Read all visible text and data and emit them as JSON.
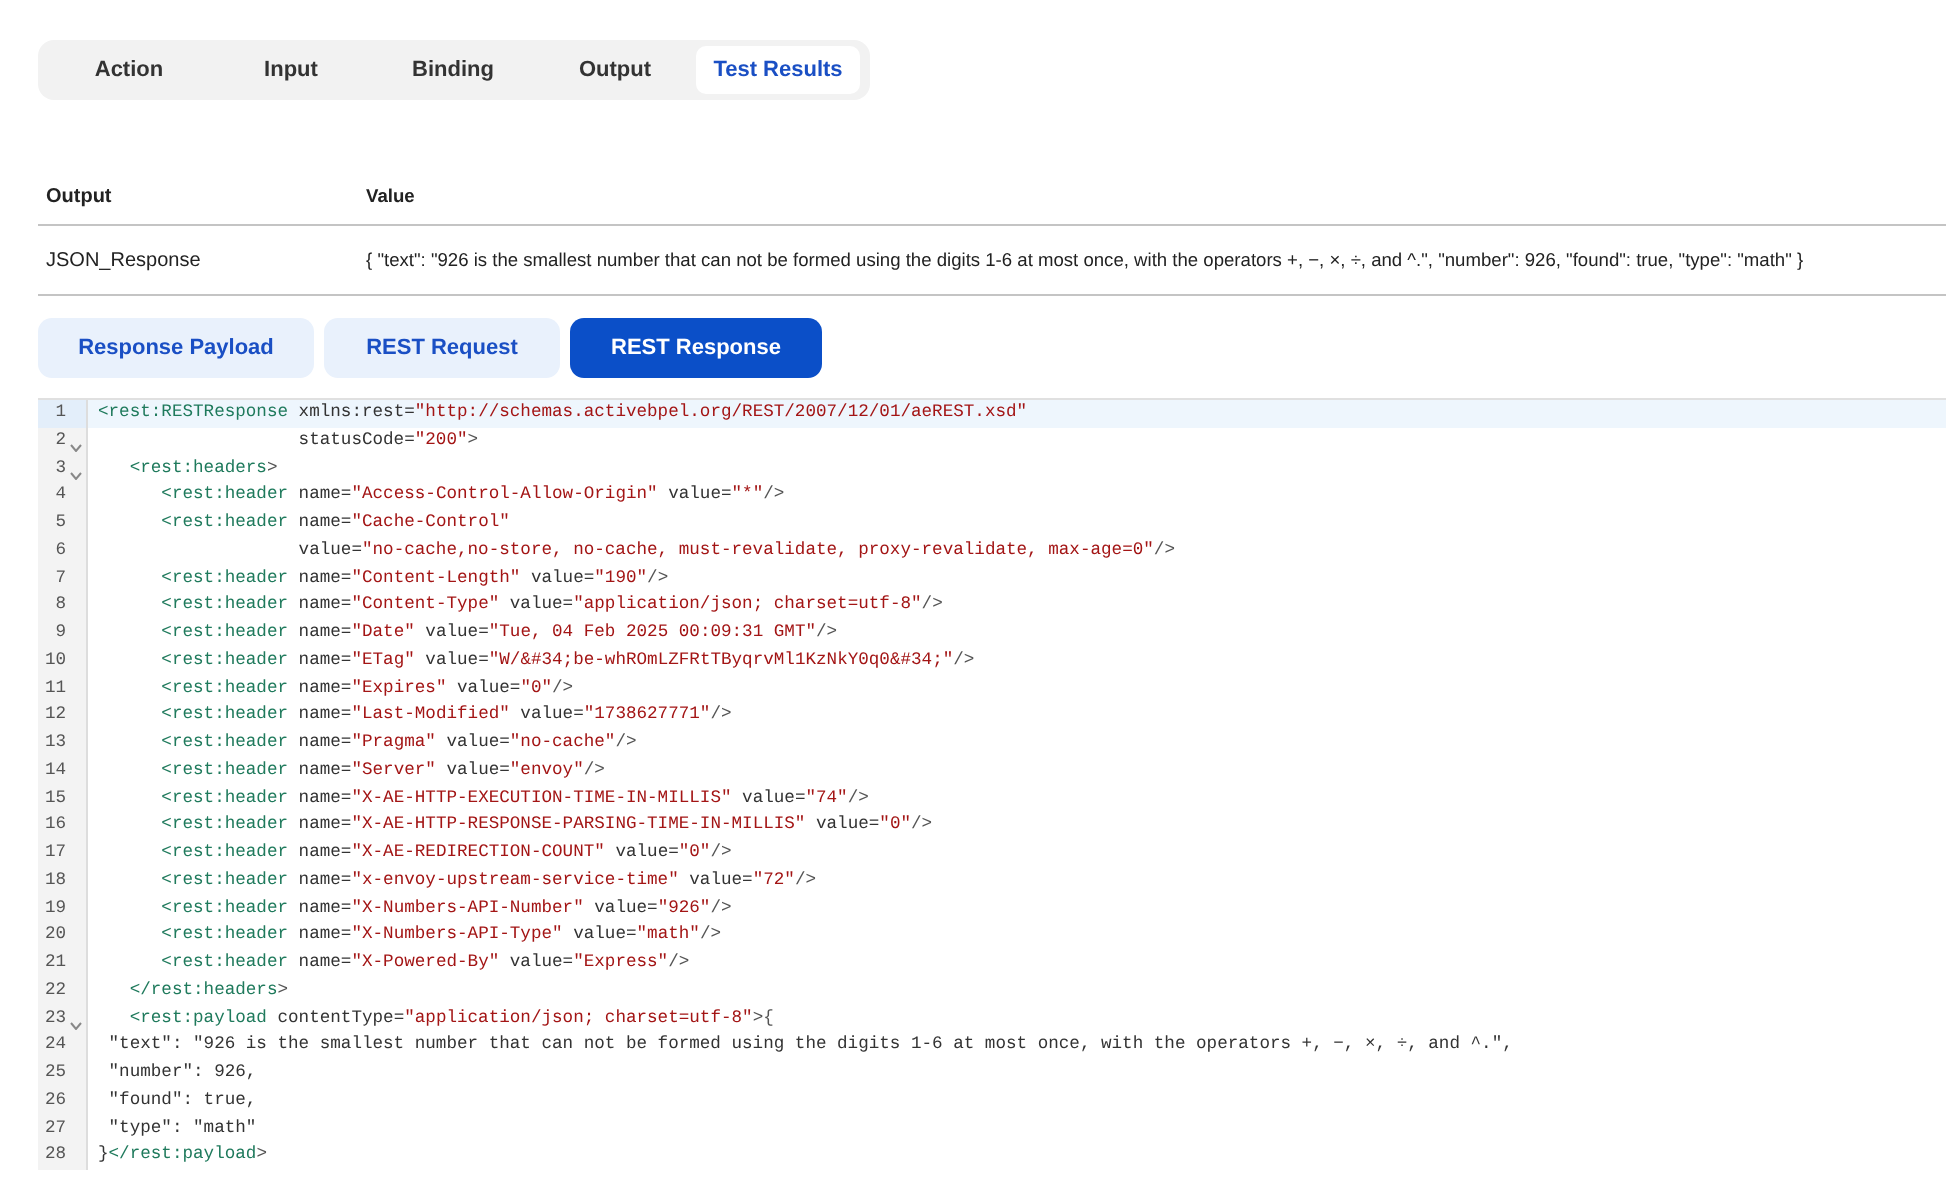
{
  "tabs": [
    {
      "label": "Action",
      "selected": false
    },
    {
      "label": "Input",
      "selected": false
    },
    {
      "label": "Binding",
      "selected": false
    },
    {
      "label": "Output",
      "selected": false
    },
    {
      "label": "Test Results",
      "selected": true
    }
  ],
  "table": {
    "columns": [
      "Output",
      "Value"
    ],
    "rows": [
      [
        "JSON_Response",
        "{ \"text\": \"926 is the smallest number that can not be formed using the digits 1-6 at most once, with the operators +, −, ×, ÷, and ^.\", \"number\": 926, \"found\": true, \"type\": \"math\" }"
      ]
    ]
  },
  "view_buttons": [
    {
      "label": "Response Payload",
      "selected": false
    },
    {
      "label": "REST Request",
      "selected": false
    },
    {
      "label": "REST Response",
      "selected": true
    }
  ],
  "editor": {
    "lines": [
      {
        "number": "1",
        "active": true,
        "foldable": false,
        "tokens": [
          {
            "kind": "tag",
            "text": "<rest:RESTResponse"
          },
          {
            "kind": "attr",
            "text": " xmlns:rest="
          },
          {
            "kind": "str",
            "text": "\"http://schemas.activebpel.org/REST/2007/12/01/aeREST.xsd\""
          }
        ]
      },
      {
        "number": "2",
        "active": false,
        "foldable": true,
        "tokens": [
          {
            "kind": "attr",
            "text": "                   statusCode="
          },
          {
            "kind": "str",
            "text": "\"200\""
          },
          {
            "kind": "punct",
            "text": ">"
          }
        ]
      },
      {
        "number": "3",
        "active": false,
        "foldable": true,
        "tokens": [
          {
            "kind": "tag",
            "text": "   <rest:headers"
          },
          {
            "kind": "punct",
            "text": ">"
          }
        ]
      },
      {
        "number": "4",
        "active": false,
        "foldable": false,
        "tokens": [
          {
            "kind": "tag",
            "text": "      <rest:header"
          },
          {
            "kind": "attr",
            "text": " name="
          },
          {
            "kind": "str",
            "text": "\"Access-Control-Allow-Origin\""
          },
          {
            "kind": "attr",
            "text": " value="
          },
          {
            "kind": "str",
            "text": "\"*\""
          },
          {
            "kind": "punct",
            "text": "/>"
          }
        ]
      },
      {
        "number": "5",
        "active": false,
        "foldable": false,
        "tokens": [
          {
            "kind": "tag",
            "text": "      <rest:header"
          },
          {
            "kind": "attr",
            "text": " name="
          },
          {
            "kind": "str",
            "text": "\"Cache-Control\""
          }
        ]
      },
      {
        "number": "6",
        "active": false,
        "foldable": false,
        "tokens": [
          {
            "kind": "attr",
            "text": "                   value="
          },
          {
            "kind": "str",
            "text": "\"no-cache,no-store, no-cache, must-revalidate, proxy-revalidate, max-age=0\""
          },
          {
            "kind": "punct",
            "text": "/>"
          }
        ]
      },
      {
        "number": "7",
        "active": false,
        "foldable": false,
        "tokens": [
          {
            "kind": "tag",
            "text": "      <rest:header"
          },
          {
            "kind": "attr",
            "text": " name="
          },
          {
            "kind": "str",
            "text": "\"Content-Length\""
          },
          {
            "kind": "attr",
            "text": " value="
          },
          {
            "kind": "str",
            "text": "\"190\""
          },
          {
            "kind": "punct",
            "text": "/>"
          }
        ]
      },
      {
        "number": "8",
        "active": false,
        "foldable": false,
        "tokens": [
          {
            "kind": "tag",
            "text": "      <rest:header"
          },
          {
            "kind": "attr",
            "text": " name="
          },
          {
            "kind": "str",
            "text": "\"Content-Type\""
          },
          {
            "kind": "attr",
            "text": " value="
          },
          {
            "kind": "str",
            "text": "\"application/json; charset=utf-8\""
          },
          {
            "kind": "punct",
            "text": "/>"
          }
        ]
      },
      {
        "number": "9",
        "active": false,
        "foldable": false,
        "tokens": [
          {
            "kind": "tag",
            "text": "      <rest:header"
          },
          {
            "kind": "attr",
            "text": " name="
          },
          {
            "kind": "str",
            "text": "\"Date\""
          },
          {
            "kind": "attr",
            "text": " value="
          },
          {
            "kind": "str",
            "text": "\"Tue, 04 Feb 2025 00:09:31 GMT\""
          },
          {
            "kind": "punct",
            "text": "/>"
          }
        ]
      },
      {
        "number": "10",
        "active": false,
        "foldable": false,
        "tokens": [
          {
            "kind": "tag",
            "text": "      <rest:header"
          },
          {
            "kind": "attr",
            "text": " name="
          },
          {
            "kind": "str",
            "text": "\"ETag\""
          },
          {
            "kind": "attr",
            "text": " value="
          },
          {
            "kind": "str",
            "text": "\"W/&#34;be-whROmLZFRtTByqrvMl1KzNkY0q0&#34;\""
          },
          {
            "kind": "punct",
            "text": "/>"
          }
        ]
      },
      {
        "number": "11",
        "active": false,
        "foldable": false,
        "tokens": [
          {
            "kind": "tag",
            "text": "      <rest:header"
          },
          {
            "kind": "attr",
            "text": " name="
          },
          {
            "kind": "str",
            "text": "\"Expires\""
          },
          {
            "kind": "attr",
            "text": " value="
          },
          {
            "kind": "str",
            "text": "\"0\""
          },
          {
            "kind": "punct",
            "text": "/>"
          }
        ]
      },
      {
        "number": "12",
        "active": false,
        "foldable": false,
        "tokens": [
          {
            "kind": "tag",
            "text": "      <rest:header"
          },
          {
            "kind": "attr",
            "text": " name="
          },
          {
            "kind": "str",
            "text": "\"Last-Modified\""
          },
          {
            "kind": "attr",
            "text": " value="
          },
          {
            "kind": "str",
            "text": "\"1738627771\""
          },
          {
            "kind": "punct",
            "text": "/>"
          }
        ]
      },
      {
        "number": "13",
        "active": false,
        "foldable": false,
        "tokens": [
          {
            "kind": "tag",
            "text": "      <rest:header"
          },
          {
            "kind": "attr",
            "text": " name="
          },
          {
            "kind": "str",
            "text": "\"Pragma\""
          },
          {
            "kind": "attr",
            "text": " value="
          },
          {
            "kind": "str",
            "text": "\"no-cache\""
          },
          {
            "kind": "punct",
            "text": "/>"
          }
        ]
      },
      {
        "number": "14",
        "active": false,
        "foldable": false,
        "tokens": [
          {
            "kind": "tag",
            "text": "      <rest:header"
          },
          {
            "kind": "attr",
            "text": " name="
          },
          {
            "kind": "str",
            "text": "\"Server\""
          },
          {
            "kind": "attr",
            "text": " value="
          },
          {
            "kind": "str",
            "text": "\"envoy\""
          },
          {
            "kind": "punct",
            "text": "/>"
          }
        ]
      },
      {
        "number": "15",
        "active": false,
        "foldable": false,
        "tokens": [
          {
            "kind": "tag",
            "text": "      <rest:header"
          },
          {
            "kind": "attr",
            "text": " name="
          },
          {
            "kind": "str",
            "text": "\"X-AE-HTTP-EXECUTION-TIME-IN-MILLIS\""
          },
          {
            "kind": "attr",
            "text": " value="
          },
          {
            "kind": "str",
            "text": "\"74\""
          },
          {
            "kind": "punct",
            "text": "/>"
          }
        ]
      },
      {
        "number": "16",
        "active": false,
        "foldable": false,
        "tokens": [
          {
            "kind": "tag",
            "text": "      <rest:header"
          },
          {
            "kind": "attr",
            "text": " name="
          },
          {
            "kind": "str",
            "text": "\"X-AE-HTTP-RESPONSE-PARSING-TIME-IN-MILLIS\""
          },
          {
            "kind": "attr",
            "text": " value="
          },
          {
            "kind": "str",
            "text": "\"0\""
          },
          {
            "kind": "punct",
            "text": "/>"
          }
        ]
      },
      {
        "number": "17",
        "active": false,
        "foldable": false,
        "tokens": [
          {
            "kind": "tag",
            "text": "      <rest:header"
          },
          {
            "kind": "attr",
            "text": " name="
          },
          {
            "kind": "str",
            "text": "\"X-AE-REDIRECTION-COUNT\""
          },
          {
            "kind": "attr",
            "text": " value="
          },
          {
            "kind": "str",
            "text": "\"0\""
          },
          {
            "kind": "punct",
            "text": "/>"
          }
        ]
      },
      {
        "number": "18",
        "active": false,
        "foldable": false,
        "tokens": [
          {
            "kind": "tag",
            "text": "      <rest:header"
          },
          {
            "kind": "attr",
            "text": " name="
          },
          {
            "kind": "str",
            "text": "\"x-envoy-upstream-service-time\""
          },
          {
            "kind": "attr",
            "text": " value="
          },
          {
            "kind": "str",
            "text": "\"72\""
          },
          {
            "kind": "punct",
            "text": "/>"
          }
        ]
      },
      {
        "number": "19",
        "active": false,
        "foldable": false,
        "tokens": [
          {
            "kind": "tag",
            "text": "      <rest:header"
          },
          {
            "kind": "attr",
            "text": " name="
          },
          {
            "kind": "str",
            "text": "\"X-Numbers-API-Number\""
          },
          {
            "kind": "attr",
            "text": " value="
          },
          {
            "kind": "str",
            "text": "\"926\""
          },
          {
            "kind": "punct",
            "text": "/>"
          }
        ]
      },
      {
        "number": "20",
        "active": false,
        "foldable": false,
        "tokens": [
          {
            "kind": "tag",
            "text": "      <rest:header"
          },
          {
            "kind": "attr",
            "text": " name="
          },
          {
            "kind": "str",
            "text": "\"X-Numbers-API-Type\""
          },
          {
            "kind": "attr",
            "text": " value="
          },
          {
            "kind": "str",
            "text": "\"math\""
          },
          {
            "kind": "punct",
            "text": "/>"
          }
        ]
      },
      {
        "number": "21",
        "active": false,
        "foldable": false,
        "tokens": [
          {
            "kind": "tag",
            "text": "      <rest:header"
          },
          {
            "kind": "attr",
            "text": " name="
          },
          {
            "kind": "str",
            "text": "\"X-Powered-By\""
          },
          {
            "kind": "attr",
            "text": " value="
          },
          {
            "kind": "str",
            "text": "\"Express\""
          },
          {
            "kind": "punct",
            "text": "/>"
          }
        ]
      },
      {
        "number": "22",
        "active": false,
        "foldable": false,
        "tokens": [
          {
            "kind": "tag",
            "text": "   </rest:headers"
          },
          {
            "kind": "punct",
            "text": ">"
          }
        ]
      },
      {
        "number": "23",
        "active": false,
        "foldable": true,
        "tokens": [
          {
            "kind": "tag",
            "text": "   <rest:payload"
          },
          {
            "kind": "attr",
            "text": " contentType="
          },
          {
            "kind": "str",
            "text": "\"application/json; charset=utf-8\""
          },
          {
            "kind": "punct",
            "text": ">{"
          }
        ]
      },
      {
        "number": "24",
        "active": false,
        "foldable": false,
        "tokens": [
          {
            "kind": "text",
            "text": " \"text\": \"926 is the smallest number that can not be formed using the digits 1-6 at most once, with the operators +, −, ×, ÷, and ^.\","
          }
        ]
      },
      {
        "number": "25",
        "active": false,
        "foldable": false,
        "tokens": [
          {
            "kind": "text",
            "text": " \"number\": 926,"
          }
        ]
      },
      {
        "number": "26",
        "active": false,
        "foldable": false,
        "tokens": [
          {
            "kind": "text",
            "text": " \"found\": true,"
          }
        ]
      },
      {
        "number": "27",
        "active": false,
        "foldable": false,
        "tokens": [
          {
            "kind": "text",
            "text": " \"type\": \"math\""
          }
        ]
      },
      {
        "number": "28",
        "active": false,
        "foldable": false,
        "tokens": [
          {
            "kind": "text",
            "text": "}"
          },
          {
            "kind": "tag",
            "text": "</rest:payload"
          },
          {
            "kind": "punct",
            "text": ">"
          }
        ]
      }
    ]
  }
}
